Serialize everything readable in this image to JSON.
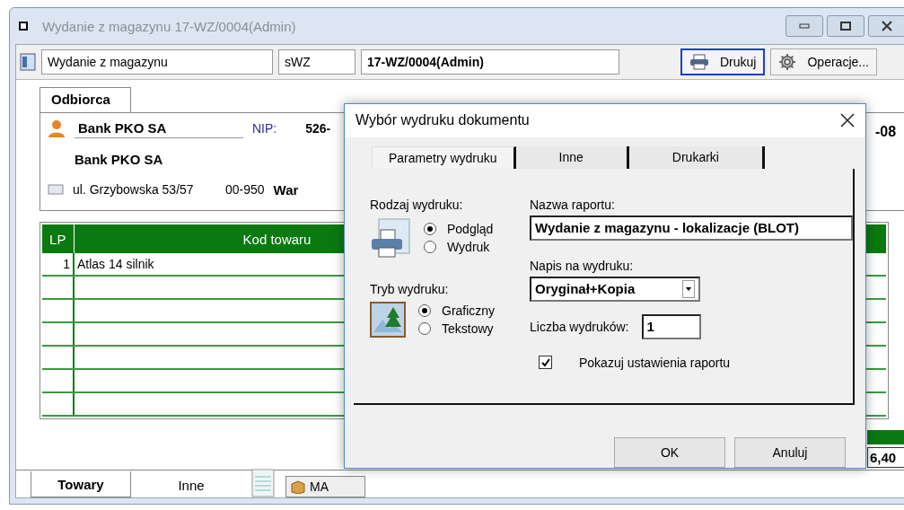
{
  "window": {
    "title": "Wydanie z magazynu 17-WZ/0004(Admin)"
  },
  "toolbar": {
    "document_type": "Wydanie z magazynu",
    "series": "sWZ",
    "number": "17-WZ/0004(Admin)",
    "buttons": [
      {
        "label": "Drukuj",
        "kind": "print",
        "focused": true
      },
      {
        "label": "Operacje...",
        "kind": "gear",
        "focused": false
      }
    ]
  },
  "recipient": {
    "tab": "Odbiorca",
    "name": "Bank PKO SA",
    "nip_label": "NIP:",
    "nip": "526-",
    "full_name": "Bank PKO SA",
    "street": "ul. Grzybowska 53/57",
    "postal_code": "00-950",
    "city": "War",
    "date_fragment": "-08"
  },
  "table": {
    "columns": [
      "LP",
      "Kod towaru"
    ],
    "rows": [
      {
        "lp": "1",
        "code": "Atlas 14 silnik"
      }
    ]
  },
  "summary": {
    "total_fragment": "6,40"
  },
  "bottom_bar": [
    {
      "kind": "tab",
      "label": "Towary",
      "selected": true
    },
    {
      "kind": "tab",
      "label": "Inne",
      "selected": false
    },
    {
      "kind": "notepad"
    },
    {
      "kind": "button",
      "label": "MA"
    }
  ],
  "dialog": {
    "title": "Wybór wydruku dokumentu",
    "tabs": [
      {
        "label": "Parametry wydruku",
        "selected": true
      },
      {
        "label": "Inne",
        "selected": false
      },
      {
        "label": "Drukarki",
        "selected": false
      }
    ],
    "groups": [
      {
        "label": "Rodzaj wydruku:",
        "kind": "printer",
        "options": [
          {
            "label": "Podgląd",
            "selected": true
          },
          {
            "label": "Wydruk",
            "selected": false
          }
        ]
      },
      {
        "label": "Tryb wydruku:",
        "kind": "picture",
        "options": [
          {
            "label": "Graficzny",
            "selected": true
          },
          {
            "label": "Tekstowy",
            "selected": false
          }
        ]
      }
    ],
    "report_name": {
      "label": "Nazwa raportu:",
      "value": "Wydanie z magazynu - lokalizacje (BLOT)"
    },
    "caption": {
      "label": "Napis na wydruku:",
      "value": "Oryginał+Kopia"
    },
    "copies": {
      "label": "Liczba wydruków:",
      "value": "1"
    },
    "show_settings": {
      "label": "Pokazuj ustawienia raportu",
      "checked": true
    },
    "buttons": [
      "OK",
      "Anuluj"
    ]
  }
}
